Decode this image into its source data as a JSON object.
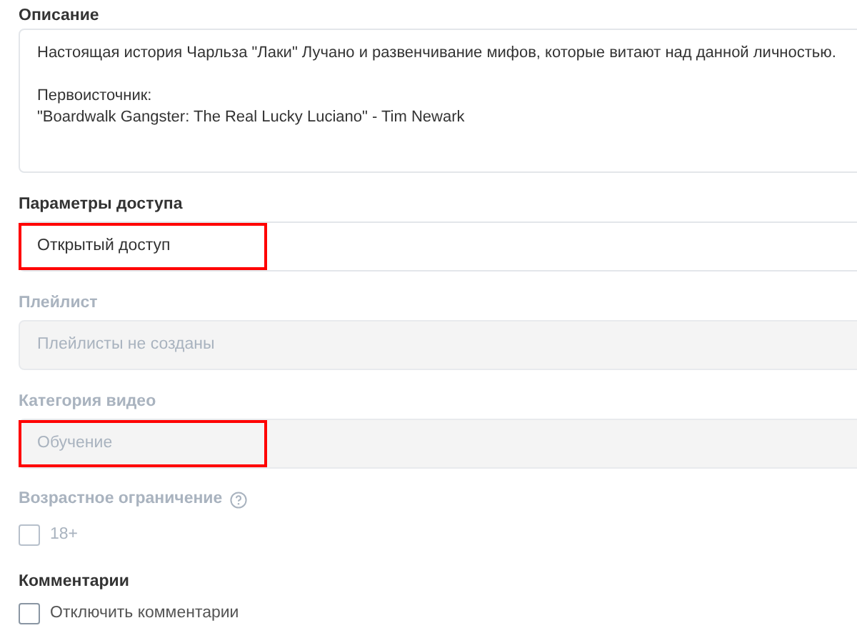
{
  "description": {
    "label": "Описание",
    "paragraphs": [
      [
        "Настоящая история Чарльза \"Лаки\" Лучано и развенчивание мифов, которые витают над данной личностью."
      ],
      [
        "Первоисточник:",
        "\"Boardwalk Gangster: The Real Lucky Luciano\" - Tim Newark"
      ]
    ]
  },
  "fields": [
    {
      "label": "Параметры доступа",
      "value": "Открытый доступ",
      "disabled": false,
      "highlighted": true
    },
    {
      "label": "Плейлист",
      "value": "Плейлисты не созданы",
      "disabled": true,
      "highlighted": false
    },
    {
      "label": "Категория видео",
      "value": "Обучение",
      "disabled": true,
      "highlighted": true
    }
  ],
  "checks": [
    {
      "label": "Возрастное ограничение",
      "help": true,
      "option": "18+",
      "checked": false,
      "disabled": true
    },
    {
      "label": "Комментарии",
      "help": false,
      "option": "Отключить комментарии",
      "checked": false,
      "disabled": false
    }
  ]
}
